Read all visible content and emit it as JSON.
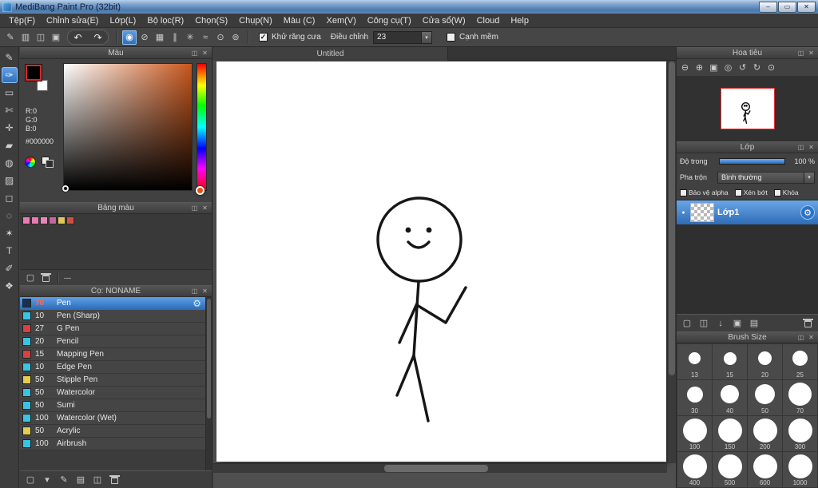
{
  "window": {
    "title": "MediBang Paint Pro (32bit)",
    "buttons": [
      {
        "name": "minimize-button",
        "glyph": "–"
      },
      {
        "name": "maximize-button",
        "glyph": "▭"
      },
      {
        "name": "close-button",
        "glyph": "✕"
      }
    ]
  },
  "menu": {
    "items": [
      "Tệp(F)",
      "Chỉnh sửa(E)",
      "Lớp(L)",
      "Bộ lọc(R)",
      "Chọn(S)",
      "Chụp(N)",
      "Màu (C)",
      "Xem(V)",
      "Công cụ(T)",
      "Cửa sổ(W)",
      "Cloud",
      "Help"
    ]
  },
  "toolbar": {
    "left_icons": [
      {
        "name": "toolbar-pen-icon",
        "glyph": "✎"
      },
      {
        "name": "toolbar-comment-icon",
        "glyph": "▥"
      },
      {
        "name": "toolbar-copy-icon",
        "glyph": "◫"
      },
      {
        "name": "toolbar-board-icon",
        "glyph": "▣"
      }
    ],
    "undo_icon": {
      "name": "undo-button",
      "glyph": "↶"
    },
    "redo_icon": {
      "name": "redo-button",
      "glyph": "↷"
    },
    "snap_icons": [
      {
        "name": "brush-snap-icon",
        "glyph": "◉",
        "selected": true
      },
      {
        "name": "snap-off-icon",
        "glyph": "⊘"
      },
      {
        "name": "snap-grid-icon",
        "glyph": "▦"
      },
      {
        "name": "snap-parallel-icon",
        "glyph": "∥"
      },
      {
        "name": "snap-cross-icon",
        "glyph": "✳"
      },
      {
        "name": "snap-curve-icon",
        "glyph": "≈"
      },
      {
        "name": "snap-circle-icon",
        "glyph": "⊙"
      },
      {
        "name": "snap-ellipse-icon",
        "glyph": "⊚"
      }
    ],
    "antialias": {
      "label": "Khử răng cưa",
      "checked": true
    },
    "adjust": {
      "label": "Điều chỉnh",
      "value": "23"
    },
    "soft_edge": {
      "label": "Cạnh mềm",
      "checked": false
    }
  },
  "tools": [
    {
      "name": "pen-tool",
      "glyph": "✎"
    },
    {
      "name": "brush-tool",
      "glyph": "✑",
      "selected": true
    },
    {
      "name": "rect-tool",
      "glyph": "▭"
    },
    {
      "name": "divide-tool",
      "glyph": "✄"
    },
    {
      "name": "move-tool",
      "glyph": "✛"
    },
    {
      "name": "fill-tool",
      "glyph": "▰"
    },
    {
      "name": "bucket-tool",
      "glyph": "◍"
    },
    {
      "name": "gradient-tool",
      "glyph": "▨"
    },
    {
      "name": "select-tool",
      "glyph": "◻"
    },
    {
      "name": "lasso-tool",
      "glyph": "◌"
    },
    {
      "name": "magic-wand-tool",
      "glyph": "✶"
    },
    {
      "name": "text-tool",
      "glyph": "T"
    },
    {
      "name": "eyedropper-tool",
      "glyph": "✐"
    },
    {
      "name": "hand-tool",
      "glyph": "❖"
    }
  ],
  "color_panel": {
    "title": "Màu",
    "r": "R:0",
    "g": "G:0",
    "b": "B:0",
    "hex": "#000000",
    "selected_hue": "#c8561c"
  },
  "palette_panel": {
    "title": "Bảng màu",
    "swatches": [
      "#e77cb5",
      "#e77cb5",
      "#df8ab8",
      "#c2689a",
      "#e0c75a",
      "#cf4f45"
    ],
    "label": "---",
    "icons": [
      {
        "name": "add-color-icon",
        "glyph": "▢"
      },
      {
        "name": "delete-color-icon",
        "glyph": "trash"
      }
    ]
  },
  "brush_panel": {
    "title": "Cọ: NONAME",
    "brushes": [
      {
        "size": "70",
        "name": "Pen",
        "color": "#16324f",
        "selected": true
      },
      {
        "size": "10",
        "name": "Pen (Sharp)",
        "color": "#38c4e4"
      },
      {
        "size": "27",
        "name": "G Pen",
        "color": "#d94040"
      },
      {
        "size": "20",
        "name": "Pencil",
        "color": "#38c4e4"
      },
      {
        "size": "15",
        "name": "Mapping Pen",
        "color": "#d94040"
      },
      {
        "size": "10",
        "name": "Edge Pen",
        "color": "#38c4e4"
      },
      {
        "size": "50",
        "name": "Stipple Pen",
        "color": "#e3cd4e"
      },
      {
        "size": "50",
        "name": "Watercolor",
        "color": "#38c4e4"
      },
      {
        "size": "50",
        "name": "Sumi",
        "color": "#38c4e4"
      },
      {
        "size": "100",
        "name": "Watercolor (Wet)",
        "color": "#38c4e4"
      },
      {
        "size": "50",
        "name": "Acrylic",
        "color": "#e3cd4e"
      },
      {
        "size": "100",
        "name": "Airbrush",
        "color": "#38c4e4"
      }
    ],
    "footer_icons": [
      {
        "name": "add-brush-icon",
        "glyph": "▢"
      },
      {
        "name": "brush-menu-icon",
        "glyph": "▾"
      },
      {
        "name": "edit-brush-icon",
        "glyph": "✎"
      },
      {
        "name": "brush-folder-icon",
        "glyph": "▤"
      },
      {
        "name": "duplicate-brush-icon",
        "glyph": "◫"
      },
      {
        "name": "delete-brush-icon",
        "glyph": "trash"
      }
    ]
  },
  "navigator_panel": {
    "title": "Hoa tiêu",
    "icons": [
      {
        "name": "zoom-out-icon",
        "glyph": "⊖"
      },
      {
        "name": "zoom-in-icon",
        "glyph": "⊕"
      },
      {
        "name": "fit-view-icon",
        "glyph": "▣"
      },
      {
        "name": "actual-size-icon",
        "glyph": "◎"
      },
      {
        "name": "rotate-left-icon",
        "glyph": "↺"
      },
      {
        "name": "rotate-right-icon",
        "glyph": "↻"
      },
      {
        "name": "reset-view-icon",
        "glyph": "⊙"
      }
    ]
  },
  "layers_panel": {
    "title": "Lớp",
    "opacity_label": "Độ trong",
    "opacity_value": "100 %",
    "blend_label": "Pha trộn",
    "blend_value": "Bình thường",
    "checkboxes": [
      "Bảo vệ alpha",
      "Xén bớt",
      "Khóa"
    ],
    "layers": [
      {
        "name": "Lớp1",
        "selected": true
      }
    ],
    "footer_icons": [
      {
        "name": "add-layer-icon",
        "glyph": "▢"
      },
      {
        "name": "duplicate-layer-icon",
        "glyph": "◫"
      },
      {
        "name": "merge-layer-icon",
        "glyph": "↓"
      },
      {
        "name": "clear-layer-icon",
        "glyph": "▣"
      },
      {
        "name": "layer-folder-icon",
        "glyph": "▤"
      },
      {
        "name": "delete-layer-icon",
        "glyph": "trash"
      }
    ]
  },
  "brush_size_panel": {
    "title": "Brush Size",
    "sizes": [
      "13",
      "15",
      "20",
      "25",
      "30",
      "40",
      "50",
      "70",
      "100",
      "150",
      "200",
      "300",
      "400",
      "500",
      "600",
      "1000"
    ]
  },
  "canvas": {
    "tab": "Untitled"
  },
  "colors": {
    "accent": "#3f86d6"
  }
}
